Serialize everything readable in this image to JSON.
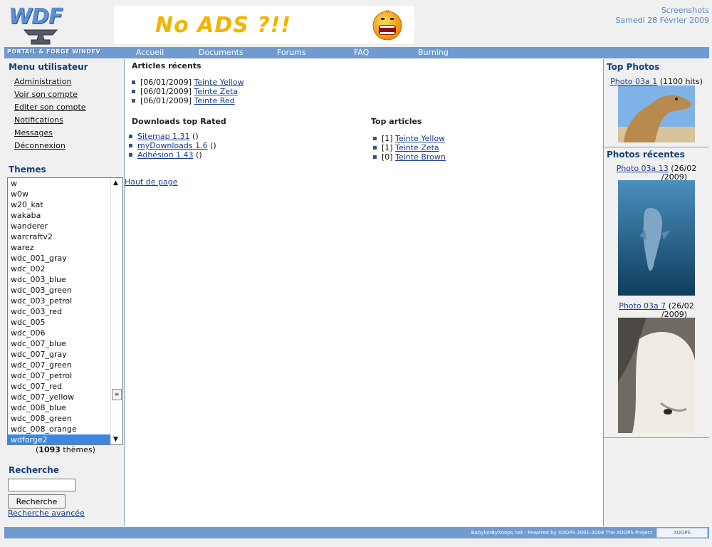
{
  "header": {
    "logo_text": "WDF",
    "banner_text": "No ADS ?!!",
    "screenshots_label": "Screenshots",
    "date": "Samedi 28 Février 2009"
  },
  "nav": {
    "brand": "PORTAIL & FORGE WINDEV",
    "items": [
      "Accueil",
      "Documents",
      "Forums",
      "FAQ",
      "Burning"
    ]
  },
  "user_menu": {
    "title": "Menu utilisateur",
    "items": [
      "Administration",
      "Voir son compte",
      "Editer son compte",
      "Notifications",
      "Messages",
      "Déconnexion"
    ]
  },
  "themes": {
    "title": "Themes",
    "options": [
      "w",
      "w0w",
      "w20_kat",
      "wakaba",
      "wanderer",
      "warcraftv2",
      "warez",
      "wdc_001_gray",
      "wdc_002",
      "wdc_003_blue",
      "wdc_003_green",
      "wdc_003_petrol",
      "wdc_003_red",
      "wdc_005",
      "wdc_006",
      "wdc_007_blue",
      "wdc_007_gray",
      "wdc_007_green",
      "wdc_007_petrol",
      "wdc_007_red",
      "wdc_007_yellow",
      "wdc_008_blue",
      "wdc_008_green",
      "wdc_008_orange",
      "wdforge2"
    ],
    "selected": "wdforge2",
    "count_prefix": "(",
    "count": "1093",
    "count_suffix": " thèmes)"
  },
  "search": {
    "title": "Recherche",
    "input_value": "",
    "button_label": "Recherche",
    "advanced_link": "Recherche avancée"
  },
  "recent_articles": {
    "title": "Articles récents",
    "items": [
      {
        "date": "[06/01/2009]",
        "title": "Teinte Yellow"
      },
      {
        "date": "[06/01/2009]",
        "title": "Teinte Zeta"
      },
      {
        "date": "[06/01/2009]",
        "title": "Teinte Red"
      }
    ]
  },
  "downloads": {
    "title": "Downloads top Rated",
    "items": [
      {
        "title": "Sitemap 1.31",
        "extra": "()"
      },
      {
        "title": "myDownloads 1.6",
        "extra": "()"
      },
      {
        "title": "Adhésion 1.43",
        "extra": "()"
      }
    ]
  },
  "top_articles": {
    "title": "Top articles",
    "items": [
      {
        "count": "[1]",
        "title": "Teinte Yellow"
      },
      {
        "count": "[1]",
        "title": "Teinte Zeta"
      },
      {
        "count": "[0]",
        "title": "Teinte Brown"
      }
    ]
  },
  "back_to_top": "Haut de page",
  "top_photos": {
    "title": "Top Photos",
    "photo_link": "Photo 03a 1",
    "photo_hits": "(1100 hits)"
  },
  "recent_photos": {
    "title": "Photos récentes",
    "items": [
      {
        "link": "Photo 03a 13",
        "date_a": "(26/02",
        "date_b": "/2009)"
      },
      {
        "link": "Photo 03a 7",
        "date_a": "(26/02",
        "date_b": "/2009)"
      }
    ]
  },
  "footer": {
    "powered": "BabylonByXoops.net - Powered by XOOPS 2001-2008 The XOOPS Project",
    "badge": "XOOPS"
  },
  "colors": {
    "nav_bar": "#6f9bd1",
    "title_blue": "#15407a",
    "link_blue": "#1a3d8f",
    "selection": "#3d87e0"
  }
}
